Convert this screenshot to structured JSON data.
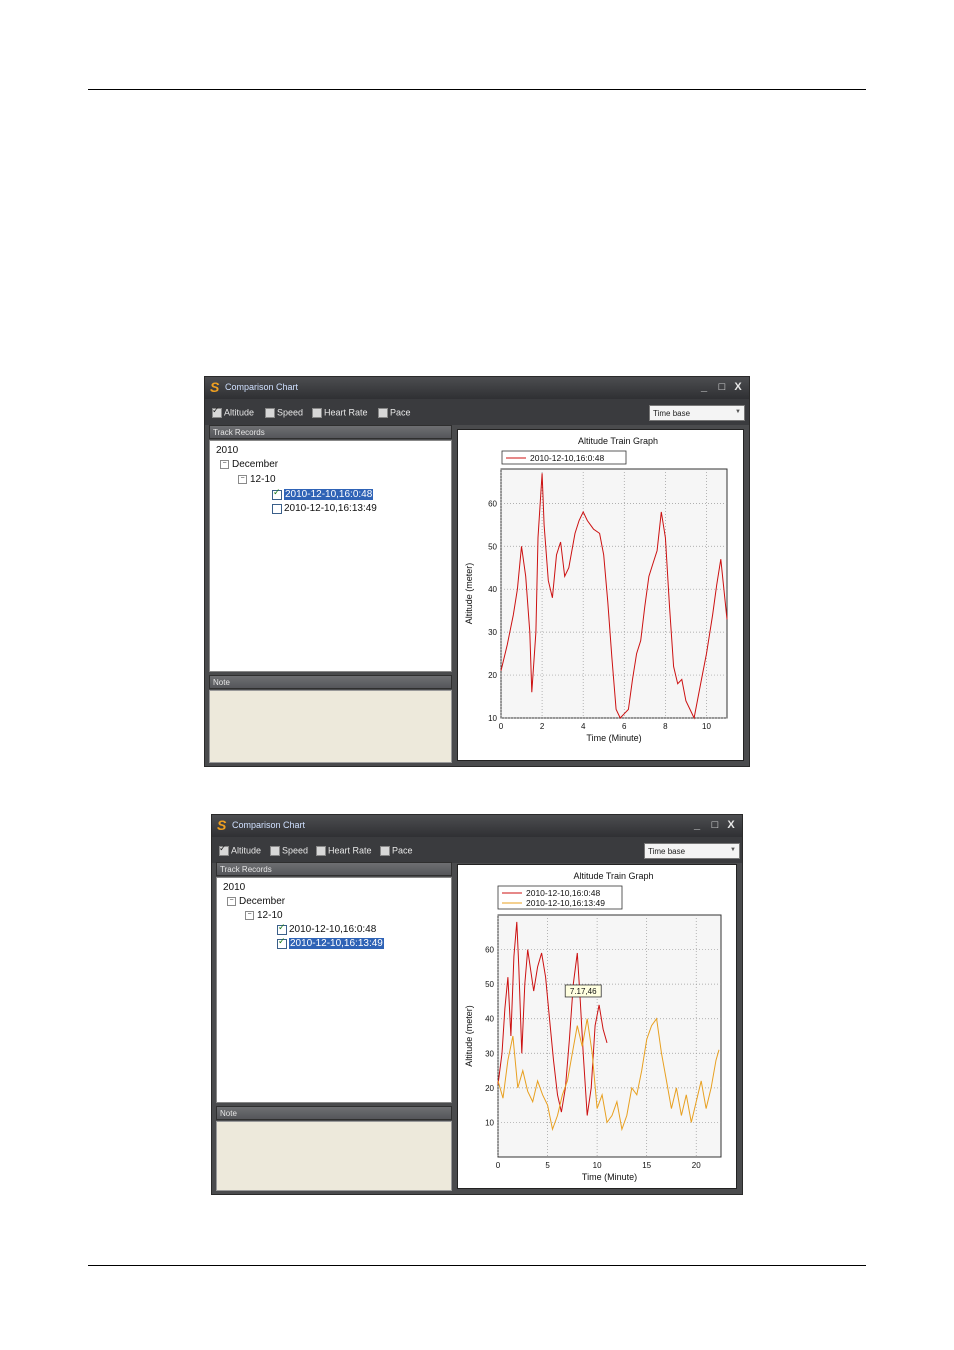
{
  "window": {
    "title": "Comparison Chart",
    "controls": [
      "_",
      "□",
      "X"
    ],
    "options": [
      {
        "label": "Altitude",
        "checked": true
      },
      {
        "label": "Speed",
        "checked": false
      },
      {
        "label": "Heart Rate",
        "checked": false
      },
      {
        "label": "Pace",
        "checked": false
      }
    ],
    "base_select": "Time base",
    "track_records_header": "Track Records",
    "note_header": "Note",
    "tree": {
      "year": "2010",
      "month": "December",
      "day": "12-10",
      "record1": "2010-12-10,16:0:48",
      "record2": "2010-12-10,16:13:49"
    }
  },
  "accent_colors": {
    "series1": "#cc1111",
    "series2": "#e8a020",
    "selection": "#2f63b6"
  },
  "chart_data": [
    {
      "type": "line",
      "title": "Altitude Train Graph",
      "xlabel": "Time (Minute)",
      "ylabel": "Altitude (meter)",
      "xlim": [
        0,
        11
      ],
      "ylim": [
        10,
        68
      ],
      "xticks": [
        0,
        2,
        4,
        6,
        8,
        10
      ],
      "yticks": [
        10,
        20,
        30,
        40,
        50,
        60
      ],
      "grid": true,
      "legend": "top-left",
      "series": [
        {
          "name": "2010-12-10,16:0:48",
          "color": "#cc1111",
          "x": [
            0,
            0.3,
            0.6,
            0.8,
            1.0,
            1.2,
            1.4,
            1.5,
            1.7,
            1.8,
            2.0,
            2.1,
            2.3,
            2.5,
            2.7,
            2.9,
            3.1,
            3.3,
            3.6,
            3.8,
            4.0,
            4.2,
            4.5,
            4.8,
            5.0,
            5.2,
            5.4,
            5.6,
            5.8,
            6.0,
            6.2,
            6.4,
            6.6,
            6.8,
            7.0,
            7.2,
            7.4,
            7.6,
            7.8,
            8.0,
            8.2,
            8.4,
            8.6,
            8.8,
            9.0,
            9.2,
            9.4,
            9.6,
            9.8,
            10.0,
            10.3,
            10.5,
            10.7,
            11.0
          ],
          "y": [
            21,
            27,
            34,
            40,
            50,
            43,
            30,
            16,
            30,
            52,
            67,
            55,
            42,
            38,
            48,
            51,
            43,
            45,
            53,
            56,
            58,
            56,
            54,
            53,
            48,
            37,
            24,
            12,
            10,
            11,
            12,
            19,
            25,
            28,
            36,
            43,
            46,
            49,
            58,
            52,
            36,
            22,
            18,
            19,
            14,
            12,
            10,
            15,
            20,
            25,
            34,
            41,
            47,
            33
          ]
        },
        {
          "name": "2010-12-10,16:13:49",
          "color": "#e8a020",
          "x": [],
          "y": []
        }
      ]
    },
    {
      "type": "line",
      "title": "Altitude Train Graph",
      "xlabel": "Time (Minute)",
      "ylabel": "Altitude (meter)",
      "xlim": [
        0,
        22.5
      ],
      "ylim": [
        0,
        70
      ],
      "xticks": [
        0,
        5,
        10,
        15,
        20
      ],
      "yticks": [
        10,
        20,
        30,
        40,
        50,
        60
      ],
      "grid": true,
      "legend": "top-left",
      "tooltip": {
        "text": "7.17,46",
        "x": 8.8,
        "y": 46
      },
      "series": [
        {
          "name": "2010-12-10,16:0:48",
          "color": "#cc1111",
          "x": [
            0,
            0.4,
            0.7,
            1.0,
            1.3,
            1.6,
            1.9,
            2.1,
            2.4,
            2.7,
            3.0,
            3.3,
            3.6,
            4.0,
            4.4,
            4.8,
            5.2,
            5.6,
            6.0,
            6.4,
            6.8,
            7.2,
            7.6,
            8.0,
            8.3,
            8.6,
            9.0,
            9.4,
            9.8,
            10.2,
            10.6,
            11.0
          ],
          "y": [
            21,
            30,
            43,
            52,
            35,
            58,
            68,
            55,
            30,
            50,
            60,
            54,
            48,
            55,
            59,
            52,
            40,
            28,
            18,
            13,
            20,
            34,
            50,
            59,
            45,
            30,
            12,
            20,
            38,
            44,
            37,
            33
          ]
        },
        {
          "name": "2010-12-10,16:13:49",
          "color": "#e8a020",
          "x": [
            0,
            0.5,
            1.0,
            1.5,
            2.0,
            2.5,
            3.0,
            3.5,
            4.0,
            4.5,
            5.0,
            5.5,
            6.0,
            6.5,
            7.0,
            7.5,
            8.0,
            8.5,
            9.0,
            9.5,
            10.0,
            10.5,
            11.0,
            11.5,
            12.0,
            12.5,
            13.0,
            13.5,
            14.0,
            14.5,
            15.0,
            15.5,
            16.0,
            16.5,
            17.0,
            17.5,
            18.0,
            18.5,
            19.0,
            19.5,
            20.0,
            20.5,
            21.0,
            21.5,
            22.0,
            22.3
          ],
          "y": [
            22,
            17,
            28,
            35,
            20,
            25,
            19,
            16,
            22,
            18,
            15,
            8,
            12,
            18,
            22,
            30,
            38,
            32,
            40,
            30,
            14,
            18,
            10,
            12,
            16,
            8,
            12,
            20,
            18,
            25,
            34,
            38,
            40,
            30,
            22,
            14,
            20,
            12,
            18,
            10,
            16,
            22,
            14,
            20,
            28,
            31
          ]
        }
      ]
    }
  ]
}
